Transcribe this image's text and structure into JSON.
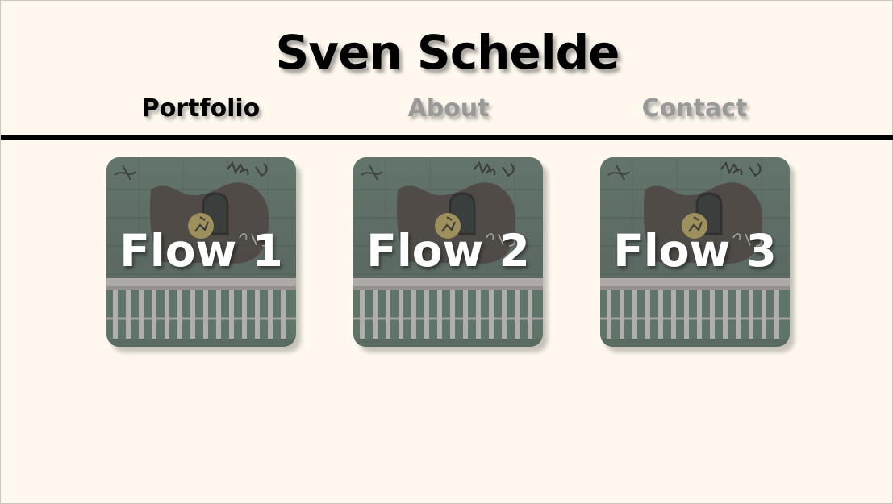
{
  "site": {
    "title": "Sven Schelde"
  },
  "nav": {
    "items": [
      {
        "label": "Portfolio",
        "active": true
      },
      {
        "label": "About",
        "active": false
      },
      {
        "label": "Contact",
        "active": false
      }
    ]
  },
  "portfolio": {
    "items": [
      {
        "label": "Flow 1"
      },
      {
        "label": "Flow 2"
      },
      {
        "label": "Flow 3"
      }
    ]
  },
  "colors": {
    "background": "#fef8ee",
    "nav_active": "#000000",
    "nav_inactive": "#999999",
    "tile_label": "#ffffff"
  }
}
